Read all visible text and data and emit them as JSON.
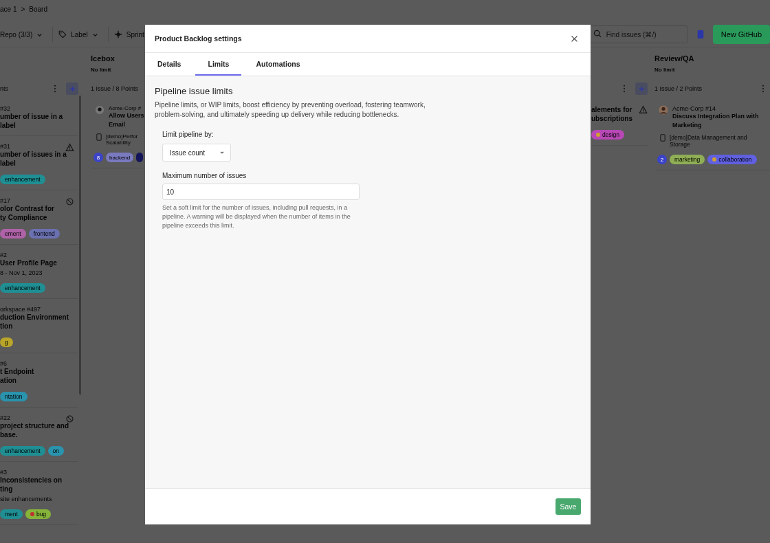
{
  "breadcrumb": {
    "items": [
      "ace 1",
      "Board"
    ],
    "separator": ">"
  },
  "toolbar": {
    "filters": [
      {
        "kind": "repo",
        "label": "Repo (3/3)",
        "caret": true
      },
      {
        "kind": "label",
        "label": "Label",
        "caret": true
      },
      {
        "kind": "sprint",
        "label": "Sprint",
        "caret": false
      }
    ],
    "search": {
      "placeholder": "Find issues (⌘/)"
    },
    "new_button": "New GitHub"
  },
  "columns": [
    {
      "count": "nts",
      "menu": true,
      "add": true,
      "cards": [
        {
          "ref": "#32",
          "title": [
            "umber of issue in a",
            "label"
          ]
        },
        {
          "ref": "#31",
          "title": [
            "umber of issues in a",
            "label"
          ],
          "alert": {
            "kind": "warning"
          },
          "tags": [
            {
              "label": "enhancement",
              "color": "#1f8f94"
            }
          ]
        },
        {
          "ref": "#17",
          "title": [
            "olor Contrast for",
            "ty Compliance"
          ],
          "alert": {
            "kind": "blocked"
          },
          "tags": [
            {
              "label": "ement",
              "color": "#b062a8"
            },
            {
              "label": "frontend",
              "color": "#6a70b0"
            }
          ]
        },
        {
          "ref": "#2",
          "title": [
            "User Profile Page"
          ],
          "meta": "8 - Nov 1, 2023",
          "tags": [
            {
              "label": "enhancement",
              "color": "#1f8f94"
            }
          ]
        },
        {
          "ref": "orkspace #497",
          "title": [
            "duction Environment",
            "tion"
          ],
          "tags": [
            {
              "label": "g",
              "color": "#b8a52a"
            }
          ]
        },
        {
          "ref": "#6",
          "title": [
            "t Endpoint",
            "ation"
          ],
          "tags": [
            {
              "label": "ntation",
              "color": "#2a93ad"
            }
          ]
        },
        {
          "ref": "#22",
          "title": [
            "project structure and",
            "base."
          ],
          "alert": {
            "kind": "blocked"
          },
          "tags": [
            {
              "label": "enhancement",
              "color": "#1f8f94"
            },
            {
              "label": "on",
              "color": "#2a93ad"
            }
          ]
        },
        {
          "ref": "#3",
          "title": [
            "Inconsistencies on",
            "ting"
          ],
          "meta": "site enhancements",
          "tags": [
            {
              "label": "ment",
              "color": "#1f8f94"
            },
            {
              "label": "bug",
              "color": "#86b43a",
              "icon": {
                "color": "#c03030"
              }
            }
          ]
        }
      ]
    },
    {
      "title": "Icebox",
      "limit": "No limit",
      "count": "1 Issue / 8 Points",
      "menu": false,
      "add": false,
      "cards": [
        {
          "ref": "Acme-Corp #",
          "title": [
            "Allow Users",
            "Email"
          ],
          "avatar": {
            "kind": "github"
          },
          "epic": [
            "[demo]Perfor",
            "Scalability"
          ],
          "estimate": "8",
          "tags": [
            {
              "label": "backend",
              "color": "#7a7ac0"
            },
            {
              "color": "#14145a"
            }
          ]
        }
      ]
    },
    {
      "menu": true,
      "add": true,
      "cards": [
        {
          "title": [
            "alements for",
            "ubscriptions"
          ],
          "alert": {
            "kind": "warning"
          },
          "tags": [
            {
              "label": "design",
              "color": "#b848b6",
              "icon": {
                "color": "#d0a030"
              }
            }
          ]
        }
      ]
    },
    {
      "title": "Review/QA",
      "limit": "No limit",
      "count": "1 Issue / 2 Points",
      "menu": true,
      "add": false,
      "cards": [
        {
          "ref": "Acme-Corp #14",
          "title": [
            "Discuss Integration Plan with",
            "Marketing"
          ],
          "avatar": {
            "kind": "person"
          },
          "epic": [
            "[demo]Data Management and",
            "Storage"
          ],
          "estimate": "2",
          "tags": [
            {
              "label": "marketing",
              "color": "#8fae55"
            },
            {
              "label": "collaboration",
              "color": "#6060e0",
              "icon": {
                "color": "#d0a030"
              }
            }
          ]
        }
      ]
    }
  ],
  "dialog": {
    "title": "Product Backlog settings",
    "tabs": [
      {
        "label": "Details",
        "selected": false
      },
      {
        "label": "Limits",
        "selected": true
      },
      {
        "label": "Automations",
        "selected": false
      }
    ],
    "heading": "Pipeline issue limits",
    "description": "Pipeline limits, or WIP limits, boost efficiency by preventing overload, fostering teamwork, problem-solving, and ultimately speeding up delivery while reducing bottlenecks.",
    "limit_by": {
      "label": "Limit pipeline by:",
      "value": "Issue count"
    },
    "maximum": {
      "label": "Maximum number of issues",
      "value": "10",
      "help": "Set a soft limit for the number of issues, including pull requests, in a pipeline. A warning will be displayed when the number of items in the pipeline exceeds this limit."
    },
    "save": "Save"
  }
}
